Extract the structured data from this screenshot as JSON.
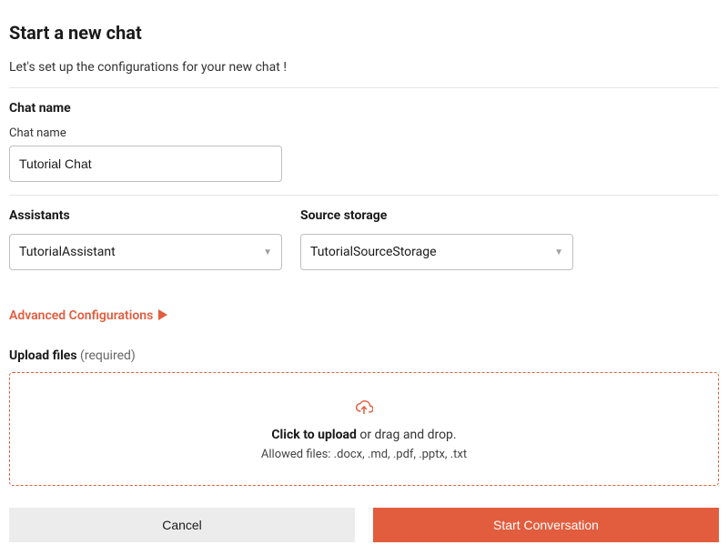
{
  "header": {
    "title": "Start a new chat",
    "subtitle": "Let's set up the configurations for your new chat !"
  },
  "chatName": {
    "sectionLabel": "Chat name",
    "fieldLabel": "Chat name",
    "value": "Tutorial Chat"
  },
  "assistants": {
    "label": "Assistants",
    "selected": "TutorialAssistant"
  },
  "sourceStorage": {
    "label": "Source storage",
    "selected": "TutorialSourceStorage"
  },
  "advanced": {
    "label": "Advanced Configurations"
  },
  "upload": {
    "label": "Upload files",
    "required": "(required)",
    "clickText": "Click to upload",
    "dragText": " or drag and drop.",
    "allowedText": "Allowed files: .docx, .md, .pdf, .pptx, .txt"
  },
  "buttons": {
    "cancel": "Cancel",
    "start": "Start Conversation"
  }
}
